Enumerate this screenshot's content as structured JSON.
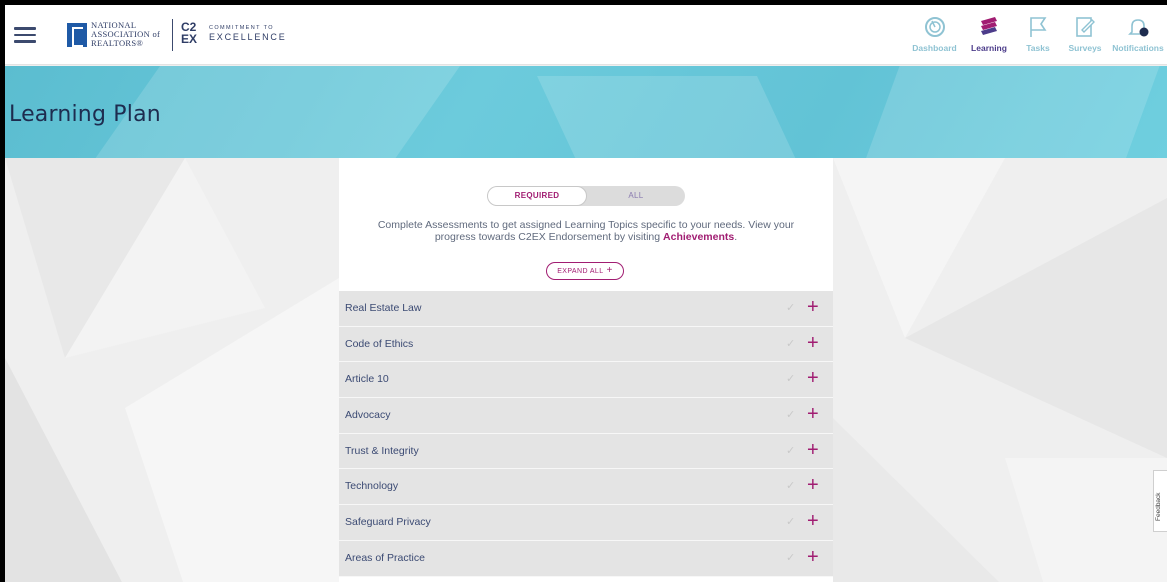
{
  "header": {
    "nar_line1": "NATIONAL",
    "nar_line2": "ASSOCIATION of",
    "nar_line3": "REALTORS®",
    "c2ex_small": "COMMITMENT TO",
    "c2ex_big": "EXCELLENCE",
    "c2ex_mark_top": "C2",
    "c2ex_mark_bottom": "EX"
  },
  "nav": [
    {
      "label": "Dashboard",
      "icon": "dashboard-icon",
      "active": false
    },
    {
      "label": "Learning",
      "icon": "learning-icon",
      "active": true
    },
    {
      "label": "Tasks",
      "icon": "tasks-icon",
      "active": false
    },
    {
      "label": "Surveys",
      "icon": "surveys-icon",
      "active": false
    },
    {
      "label": "Notifications",
      "icon": "notifications-icon",
      "active": false
    }
  ],
  "page": {
    "title": "Learning Plan"
  },
  "toggle": {
    "required": "REQUIRED",
    "all": "ALL"
  },
  "intro": {
    "text_before": "Complete Assessments to get assigned Learning Topics specific to your needs. View your progress towards C2EX Endorsement by visiting ",
    "link": "Achievements",
    "text_after": "."
  },
  "expand_all": "EXPAND ALL",
  "topics": [
    "Real Estate Law",
    "Code of Ethics",
    "Article 10",
    "Advocacy",
    "Trust & Integrity",
    "Technology",
    "Safeguard Privacy",
    "Areas of Practice"
  ],
  "feedback": "Feedback",
  "colors": {
    "accent": "#a11d72",
    "nav_inactive": "#8fc3d3",
    "nav_active": "#4c3c8a",
    "banner": "#6ccbdc",
    "navy": "#2f3d66"
  }
}
